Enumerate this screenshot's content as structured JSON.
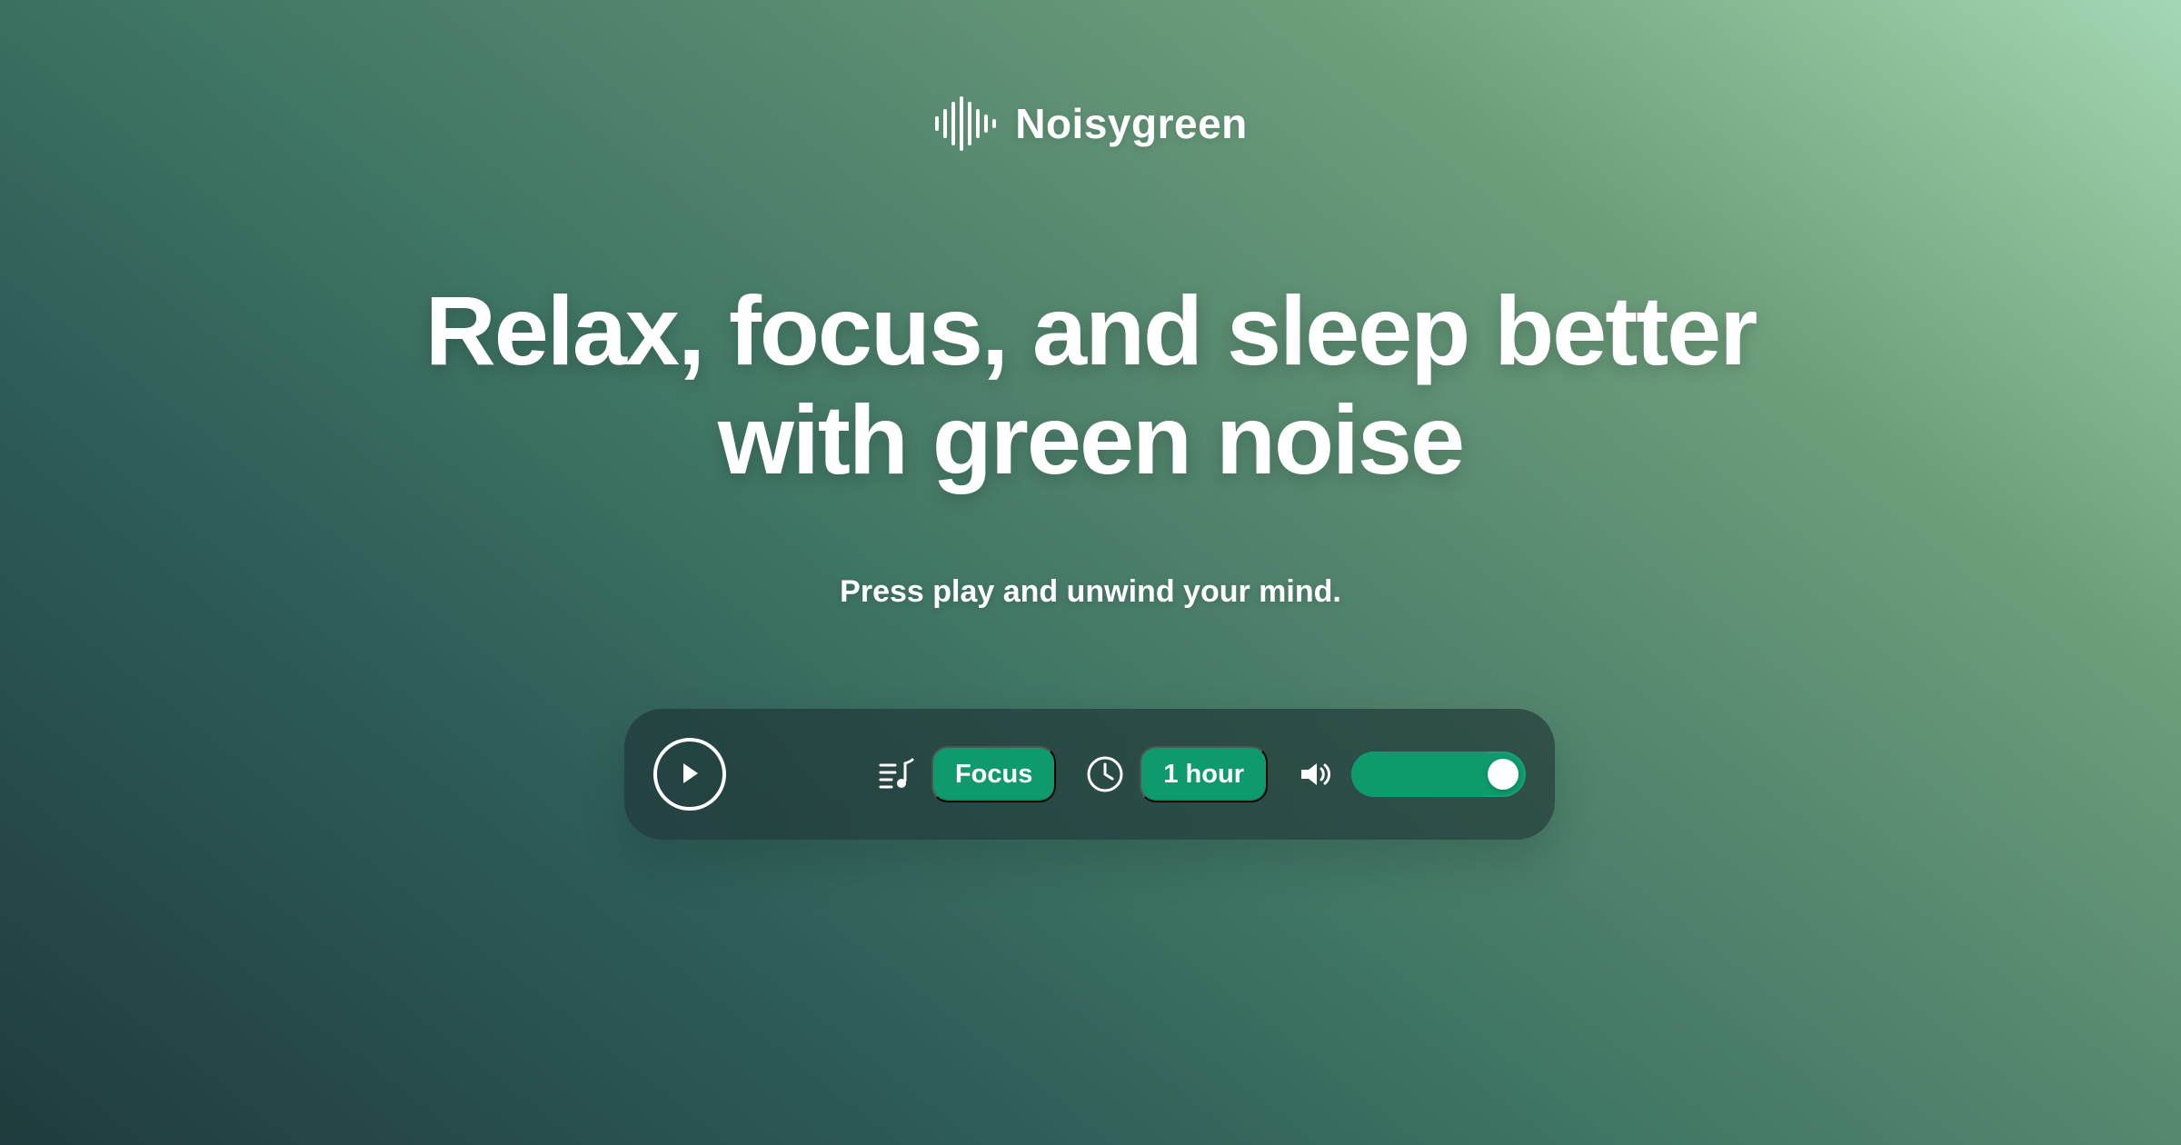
{
  "brand": {
    "name": "Noisygreen",
    "logo_icon": "soundwave-icon"
  },
  "hero": {
    "headline_line1": "Relax, focus, and sleep better",
    "headline_line2": "with green noise",
    "subhead": "Press play and unwind your mind."
  },
  "player": {
    "play_icon": "play-icon",
    "mode_icon": "playlist-music-icon",
    "mode_label": "Focus",
    "timer_icon": "clock-icon",
    "timer_label": "1 hour",
    "volume_icon": "volume-icon",
    "volume_level_percent": 88
  },
  "colors": {
    "accent_green": "#0f9a6d",
    "panel_dark": "#223d3d",
    "text_white": "#ffffff"
  }
}
